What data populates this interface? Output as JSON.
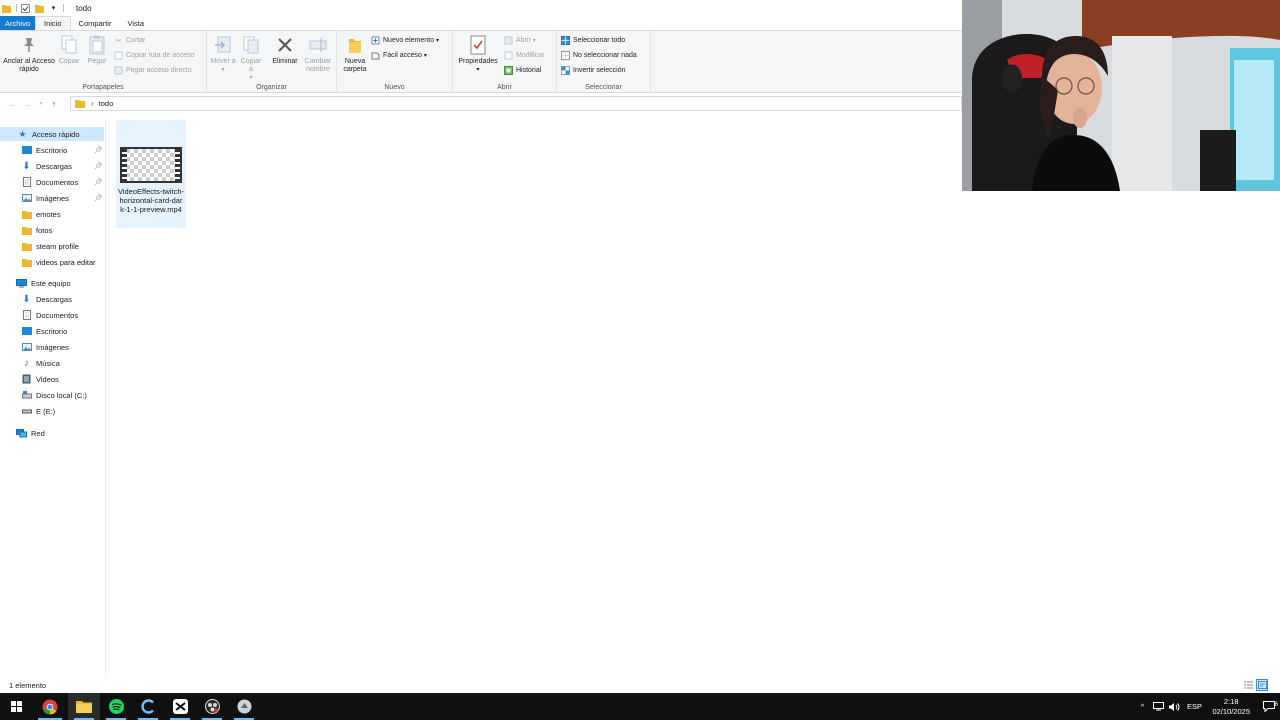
{
  "window": {
    "title": "todo"
  },
  "tabs": [
    {
      "label": "Archivo"
    },
    {
      "label": "Inicio"
    },
    {
      "label": "Compartir"
    },
    {
      "label": "Vista"
    }
  ],
  "ribbon": {
    "portapapeles": {
      "label": "Portapapeles",
      "pin": "Anclar al Acceso rápido",
      "copy": "Copiar",
      "paste": "Pegar",
      "cut": "Cortar",
      "copy_path": "Copiar ruta de acceso",
      "paste_shortcut": "Pegar acceso directo"
    },
    "organizar": {
      "label": "Organizar",
      "move": "Mover a",
      "copy_to": "Copiar a",
      "delete": "Eliminar",
      "rename": "Cambiar nombre"
    },
    "nuevo": {
      "label": "Nuevo",
      "new_folder": "Nueva carpeta",
      "new_item": "Nuevo elemento",
      "easy_access": "Fácil acceso"
    },
    "abrir": {
      "label": "Abrir",
      "properties": "Propiedades",
      "open": "Abrir",
      "edit": "Modificar",
      "history": "Historial"
    },
    "seleccionar": {
      "label": "Seleccionar",
      "select_all": "Seleccionar todo",
      "select_none": "No seleccionar nada",
      "invert": "Invertir selección"
    }
  },
  "address": {
    "path": "todo"
  },
  "nav": {
    "quick_access": "Acceso rápido",
    "quick_items": [
      {
        "label": "Escritorio",
        "pinned": true
      },
      {
        "label": "Descargas",
        "pinned": true
      },
      {
        "label": "Documentos",
        "pinned": true
      },
      {
        "label": "Imágenes",
        "pinned": true
      },
      {
        "label": "emotes"
      },
      {
        "label": "fotos"
      },
      {
        "label": "steam profile"
      },
      {
        "label": "videos para editar"
      }
    ],
    "this_pc": "Este equipo",
    "pc_items": [
      {
        "label": "Descargas"
      },
      {
        "label": "Documentos"
      },
      {
        "label": "Escritorio"
      },
      {
        "label": "Imágenes"
      },
      {
        "label": "Música"
      },
      {
        "label": "Videos"
      },
      {
        "label": "Disco local (C:)"
      },
      {
        "label": "E (E:)"
      }
    ],
    "network": "Red"
  },
  "files": [
    {
      "name": "VideoEffects-twitch-horizontal-card-dark-1-1-preview.mp4",
      "icon": "video-file-icon"
    }
  ],
  "status": {
    "count": "1 elemento"
  },
  "taskbar": {
    "apps": [
      "start-icon",
      "chrome-icon",
      "file-explorer-icon",
      "spotify-icon",
      "app-c-icon",
      "capcut-icon",
      "obs-icon",
      "app-icon"
    ],
    "language": "ESP",
    "time": "2:18",
    "date": "02/10/2025",
    "notifications": "6"
  },
  "colors": {
    "accent": "#1979ca",
    "selection": "#cce8ff",
    "taskbar": "#101010"
  }
}
